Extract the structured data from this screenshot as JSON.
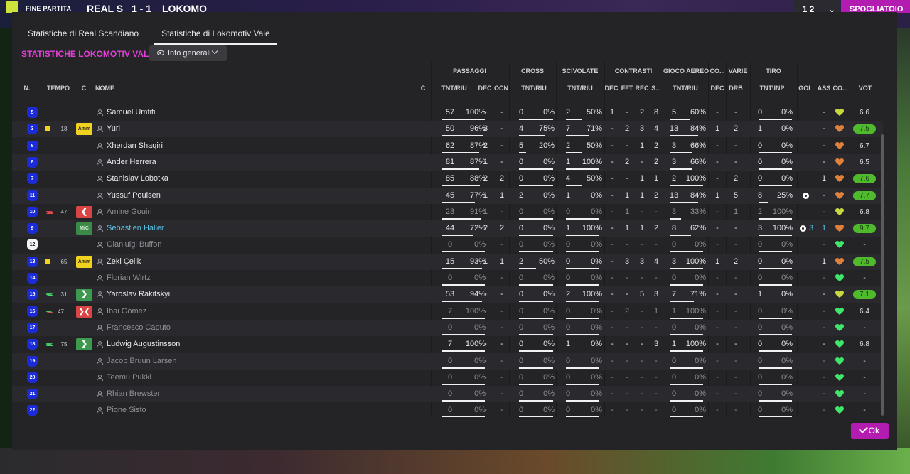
{
  "topbar": {
    "status": "FINE PARTITA",
    "team_home": "REAL S",
    "score": "1 - 1",
    "team_away": "LOKOMO",
    "right_a": "1 2",
    "right_c": "SPOGLIATOIO"
  },
  "tabs": [
    "Statistiche di Real Scandiano",
    "Statistiche di Lokomotiv Vale"
  ],
  "panel_title": "STATISTICHE LOKOMOTIV VALE",
  "dropdown_label": "Info generali",
  "groups": {
    "passaggi": "PASSAGGI",
    "cross": "CROSS",
    "scivolate": "SCIVOLATE",
    "contrasti": "CONTRASTI",
    "gioco_aereo": "GIOCO AEREO",
    "co": "CO...",
    "varie": "VARIE",
    "tiro": "TIRO"
  },
  "headers": {
    "n": "N.",
    "tempo": "TEMPO",
    "c": "C",
    "nome": "NOME",
    "c2": "C",
    "pass_tnt": "TNT/RIU",
    "pass_dec": "DEC",
    "pass_ocn": "OCN",
    "cross_tnt": "TNT/RIU",
    "sciv_tnt": "TNT/RIU",
    "con_dec": "DEC",
    "con_fft": "FFT",
    "con_rec": "REC",
    "con_s": "S...",
    "aer_tnt": "TNT/RIU",
    "co_dec": "DEC",
    "var_drb": "DRB",
    "tiro_tnt": "TNT\\INP",
    "gol": "GOL",
    "ass": "ASS",
    "co2": "CO...",
    "vot": "VOT"
  },
  "rows": [
    {
      "num": "5",
      "name": "Samuel Umtiti",
      "pass": [
        "57",
        "100%"
      ],
      "pdec": "-",
      "pocn": "-",
      "cross": [
        "0",
        "0%"
      ],
      "sciv": [
        "2",
        "50%"
      ],
      "con": [
        "1",
        "-",
        "2",
        "8"
      ],
      "aer": [
        "5",
        "60%"
      ],
      "codec": "-",
      "drb": "-",
      "tiro": [
        "0",
        "0%"
      ],
      "gol": "",
      "ass": "-",
      "heart": "yellow",
      "vot": "6.6",
      "votc": "plain"
    },
    {
      "num": "3",
      "name": "Yuri",
      "card": "yc",
      "time": "18",
      "badge": "amm",
      "badge_label": "Amm",
      "pass": [
        "50",
        "96%"
      ],
      "pdec": "3",
      "pocn": "-",
      "cross": [
        "4",
        "75%"
      ],
      "sciv": [
        "7",
        "71%"
      ],
      "con": [
        "-",
        "2",
        "3",
        "4"
      ],
      "aer": [
        "13",
        "84%"
      ],
      "codec": "1",
      "drb": "2",
      "tiro": [
        "1",
        "0%"
      ],
      "gol": "",
      "ass": "-",
      "heart": "orange",
      "vot": "7.5",
      "votc": "green"
    },
    {
      "num": "6",
      "name": "Xherdan Shaqiri",
      "pass": [
        "62",
        "87%"
      ],
      "pdec": "2",
      "pocn": "-",
      "cross": [
        "5",
        "20%"
      ],
      "sciv": [
        "2",
        "50%"
      ],
      "con": [
        "-",
        "-",
        "1",
        "2"
      ],
      "aer": [
        "3",
        "66%"
      ],
      "codec": "-",
      "drb": "-",
      "tiro": [
        "0",
        "0%"
      ],
      "gol": "",
      "ass": "-",
      "heart": "orange",
      "vot": "6.7",
      "votc": "plain"
    },
    {
      "num": "8",
      "name": "Ander Herrera",
      "pass": [
        "81",
        "87%"
      ],
      "pdec": "1",
      "pocn": "-",
      "cross": [
        "0",
        "0%"
      ],
      "sciv": [
        "1",
        "100%"
      ],
      "con": [
        "-",
        "2",
        "-",
        "2"
      ],
      "aer": [
        "3",
        "66%"
      ],
      "codec": "-",
      "drb": "-",
      "tiro": [
        "0",
        "0%"
      ],
      "gol": "",
      "ass": "-",
      "heart": "orange",
      "vot": "6.5",
      "votc": "plain"
    },
    {
      "num": "7",
      "name": "Stanislav Lobotka",
      "pass": [
        "85",
        "88%"
      ],
      "pdec": "2",
      "pocn": "2",
      "cross": [
        "0",
        "0%"
      ],
      "sciv": [
        "4",
        "50%"
      ],
      "con": [
        "-",
        "-",
        "1",
        "1"
      ],
      "aer": [
        "2",
        "100%"
      ],
      "codec": "-",
      "drb": "2",
      "tiro": [
        "0",
        "0%"
      ],
      "gol": "",
      "ass": "1",
      "heart": "orange",
      "vot": "7.6",
      "votc": "green"
    },
    {
      "num": "11",
      "name": "Yussuf Poulsen",
      "pass": [
        "45",
        "77%"
      ],
      "pdec": "1",
      "pocn": "1",
      "cross": [
        "2",
        "0%"
      ],
      "sciv": [
        "1",
        "0%"
      ],
      "con": [
        "-",
        "1",
        "1",
        "2"
      ],
      "aer": [
        "13",
        "84%"
      ],
      "codec": "1",
      "drb": "5",
      "tiro": [
        "8",
        "25%"
      ],
      "gol": "ball",
      "ass": "-",
      "heart": "orange",
      "vot": "7.7",
      "votc": "green"
    },
    {
      "num": "10",
      "name": "Amine Gouiri",
      "card": "sub-out",
      "time": "47",
      "badge": "sostout",
      "badge_label": "❮",
      "dim": true,
      "pass": [
        "23",
        "91%"
      ],
      "pdec": "1",
      "pocn": "-",
      "cross": [
        "0",
        "0%"
      ],
      "sciv": [
        "0",
        "0%"
      ],
      "con": [
        "-",
        "1",
        "-",
        "-"
      ],
      "aer": [
        "3",
        "33%"
      ],
      "codec": "-",
      "drb": "1",
      "tiro": [
        "2",
        "100%"
      ],
      "gol": "",
      "ass": "-",
      "heart": "yellow",
      "vot": "6.8",
      "votc": "plain"
    },
    {
      "num": "9",
      "name": "Sébastien Haller",
      "badge": "mic",
      "badge_label": "MiC",
      "link": true,
      "pass": [
        "44",
        "72%"
      ],
      "pdec": "2",
      "pocn": "2",
      "cross": [
        "0",
        "0%"
      ],
      "sciv": [
        "1",
        "100%"
      ],
      "con": [
        "-",
        "1",
        "1",
        "2"
      ],
      "aer": [
        "8",
        "62%"
      ],
      "codec": "-",
      "drb": "-",
      "tiro": [
        "3",
        "100%"
      ],
      "gol": "ball3",
      "gol_text": "3",
      "ass": "1",
      "heart": "orange",
      "vot": "9.7",
      "votc": "green"
    },
    {
      "num": "12",
      "name": "Gianluigi Buffon",
      "gk": true,
      "dim": true,
      "pass": [
        "0",
        "0%"
      ],
      "pdec": "-",
      "pocn": "-",
      "cross": [
        "0",
        "0%"
      ],
      "sciv": [
        "0",
        "0%"
      ],
      "con": [
        "-",
        "-",
        "-",
        "-"
      ],
      "aer": [
        "0",
        "0%"
      ],
      "codec": "-",
      "drb": "-",
      "tiro": [
        "0",
        "0%"
      ],
      "gol": "",
      "ass": "-",
      "heart": "green",
      "vot": "-",
      "votc": "plain"
    },
    {
      "num": "13",
      "name": "Zeki Çelik",
      "card": "yc",
      "time": "65",
      "badge": "amm",
      "badge_label": "Amm",
      "pass": [
        "15",
        "93%"
      ],
      "pdec": "1",
      "pocn": "1",
      "cross": [
        "2",
        "50%"
      ],
      "sciv": [
        "0",
        "0%"
      ],
      "con": [
        "-",
        "3",
        "3",
        "4"
      ],
      "aer": [
        "3",
        "100%"
      ],
      "codec": "1",
      "drb": "2",
      "tiro": [
        "0",
        "0%"
      ],
      "gol": "",
      "ass": "1",
      "heart": "orange",
      "vot": "7.5",
      "votc": "green"
    },
    {
      "num": "14",
      "name": "Florian Wirtz",
      "dim": true,
      "pass": [
        "0",
        "0%"
      ],
      "pdec": "-",
      "pocn": "-",
      "cross": [
        "0",
        "0%"
      ],
      "sciv": [
        "0",
        "0%"
      ],
      "con": [
        "-",
        "-",
        "-",
        "-"
      ],
      "aer": [
        "0",
        "0%"
      ],
      "codec": "-",
      "drb": "-",
      "tiro": [
        "0",
        "0%"
      ],
      "gol": "",
      "ass": "-",
      "heart": "green",
      "vot": "-",
      "votc": "plain"
    },
    {
      "num": "15",
      "name": "Yaroslav Rakitskyi",
      "card": "sub-in",
      "time": "31",
      "badge": "sostin",
      "badge_label": "❯",
      "pass": [
        "53",
        "94%"
      ],
      "pdec": "-",
      "pocn": "-",
      "cross": [
        "0",
        "0%"
      ],
      "sciv": [
        "2",
        "100%"
      ],
      "con": [
        "-",
        "-",
        "5",
        "3"
      ],
      "aer": [
        "7",
        "71%"
      ],
      "codec": "-",
      "drb": "-",
      "tiro": [
        "1",
        "0%"
      ],
      "gol": "",
      "ass": "-",
      "heart": "yellow",
      "vot": "7.1",
      "votc": "green"
    },
    {
      "num": "16",
      "name": "Ibai Gómez",
      "card": "sub-both",
      "time": "47,...",
      "badge": "sostboth",
      "badge_label": "❯❮",
      "dim": true,
      "pass": [
        "7",
        "100%"
      ],
      "pdec": "-",
      "pocn": "-",
      "cross": [
        "0",
        "0%"
      ],
      "sciv": [
        "0",
        "0%"
      ],
      "con": [
        "-",
        "2",
        "-",
        "1"
      ],
      "aer": [
        "1",
        "100%"
      ],
      "codec": "-",
      "drb": "-",
      "tiro": [
        "0",
        "0%"
      ],
      "gol": "",
      "ass": "-",
      "heart": "green",
      "vot": "6.4",
      "votc": "plain"
    },
    {
      "num": "17",
      "name": "Francesco Caputo",
      "dim": true,
      "pass": [
        "0",
        "0%"
      ],
      "pdec": "-",
      "pocn": "-",
      "cross": [
        "0",
        "0%"
      ],
      "sciv": [
        "0",
        "0%"
      ],
      "con": [
        "-",
        "-",
        "-",
        "-"
      ],
      "aer": [
        "0",
        "0%"
      ],
      "codec": "-",
      "drb": "-",
      "tiro": [
        "0",
        "0%"
      ],
      "gol": "",
      "ass": "-",
      "heart": "green",
      "vot": "-",
      "votc": "plain"
    },
    {
      "num": "18",
      "name": "Ludwig Augustinsson",
      "card": "sub-in",
      "time": "75",
      "badge": "sostin",
      "badge_label": "❯",
      "pass": [
        "7",
        "100%"
      ],
      "pdec": "-",
      "pocn": "-",
      "cross": [
        "0",
        "0%"
      ],
      "sciv": [
        "1",
        "0%"
      ],
      "con": [
        "-",
        "-",
        "-",
        "3"
      ],
      "aer": [
        "1",
        "100%"
      ],
      "codec": "-",
      "drb": "-",
      "tiro": [
        "0",
        "0%"
      ],
      "gol": "",
      "ass": "-",
      "heart": "green",
      "vot": "6.8",
      "votc": "plain"
    },
    {
      "num": "19",
      "name": "Jacob Bruun Larsen",
      "dim": true,
      "pass": [
        "0",
        "0%"
      ],
      "pdec": "-",
      "pocn": "-",
      "cross": [
        "0",
        "0%"
      ],
      "sciv": [
        "0",
        "0%"
      ],
      "con": [
        "-",
        "-",
        "-",
        "-"
      ],
      "aer": [
        "0",
        "0%"
      ],
      "codec": "-",
      "drb": "-",
      "tiro": [
        "0",
        "0%"
      ],
      "gol": "",
      "ass": "-",
      "heart": "green",
      "vot": "-",
      "votc": "plain"
    },
    {
      "num": "20",
      "name": "Teemu Pukki",
      "dim": true,
      "pass": [
        "0",
        "0%"
      ],
      "pdec": "-",
      "pocn": "-",
      "cross": [
        "0",
        "0%"
      ],
      "sciv": [
        "0",
        "0%"
      ],
      "con": [
        "-",
        "-",
        "-",
        "-"
      ],
      "aer": [
        "0",
        "0%"
      ],
      "codec": "-",
      "drb": "-",
      "tiro": [
        "0",
        "0%"
      ],
      "gol": "",
      "ass": "-",
      "heart": "green",
      "vot": "-",
      "votc": "plain"
    },
    {
      "num": "21",
      "name": "Rhian Brewster",
      "dim": true,
      "pass": [
        "0",
        "0%"
      ],
      "pdec": "-",
      "pocn": "-",
      "cross": [
        "0",
        "0%"
      ],
      "sciv": [
        "0",
        "0%"
      ],
      "con": [
        "-",
        "-",
        "-",
        "-"
      ],
      "aer": [
        "0",
        "0%"
      ],
      "codec": "-",
      "drb": "-",
      "tiro": [
        "0",
        "0%"
      ],
      "gol": "",
      "ass": "-",
      "heart": "green",
      "vot": "-",
      "votc": "plain"
    },
    {
      "num": "22",
      "name": "Pione Sisto",
      "dim": true,
      "pass": [
        "0",
        "0%"
      ],
      "pdec": "-",
      "pocn": "-",
      "cross": [
        "0",
        "0%"
      ],
      "sciv": [
        "0",
        "0%"
      ],
      "con": [
        "-",
        "-",
        "-",
        "-"
      ],
      "aer": [
        "0",
        "0%"
      ],
      "codec": "-",
      "drb": "-",
      "tiro": [
        "0",
        "0%"
      ],
      "gol": "",
      "ass": "-",
      "heart": "green",
      "vot": "-",
      "votc": "plain"
    }
  ],
  "colors": {
    "accent": "#b31cb0",
    "title": "#e23fd8",
    "rating_green": "#4fba2c",
    "heart_green": "#3ee66a",
    "heart_yellow": "#c8d840",
    "heart_orange": "#e0803a"
  },
  "ok_label": "Ok"
}
